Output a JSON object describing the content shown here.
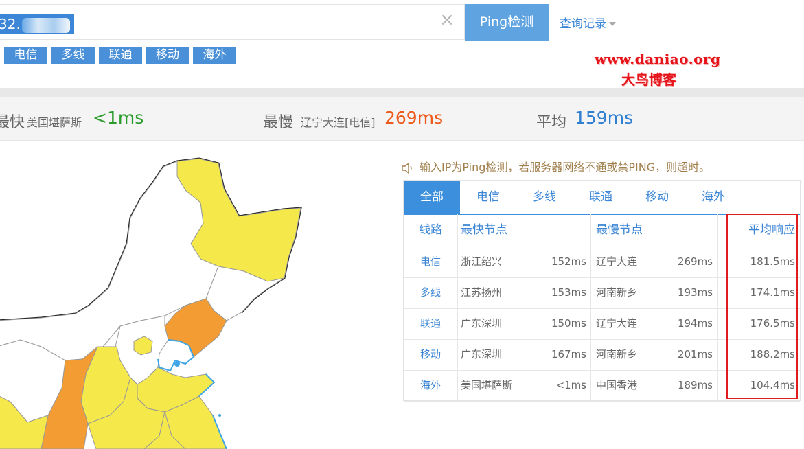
{
  "search": {
    "value": "32."
  },
  "ping_button": "Ping检测",
  "history": {
    "label": "查询记录"
  },
  "filters": [
    "电信",
    "多线",
    "联通",
    "移动",
    "海外"
  ],
  "watermark": {
    "line1": "www.daniao.org",
    "line2": "大鸟博客"
  },
  "stats": {
    "fastest": {
      "label": "最快",
      "place": "美国堪萨斯",
      "value": "<1ms"
    },
    "slowest": {
      "label": "最慢",
      "place": "辽宁大连[电信]",
      "value": "269ms"
    },
    "average": {
      "label": "平均",
      "value": "159ms"
    }
  },
  "notice": "输入IP为Ping检测，若服务器网络不通或禁PING，则超时。",
  "tabs": [
    "全部",
    "电信",
    "多线",
    "联通",
    "移动",
    "海外"
  ],
  "table": {
    "headers": {
      "line": "线路",
      "fastest": "最快节点",
      "slowest": "最慢节点",
      "avg": "平均响应"
    },
    "rows": [
      {
        "line": "电信",
        "fast_node": "浙江绍兴",
        "fast_ms": "152ms",
        "slow_node": "辽宁大连",
        "slow_ms": "269ms",
        "avg": "181.5ms"
      },
      {
        "line": "多线",
        "fast_node": "江苏扬州",
        "fast_ms": "153ms",
        "slow_node": "河南新乡",
        "slow_ms": "193ms",
        "avg": "174.1ms"
      },
      {
        "line": "联通",
        "fast_node": "广东深圳",
        "fast_ms": "150ms",
        "slow_node": "辽宁大连",
        "slow_ms": "194ms",
        "avg": "176.5ms"
      },
      {
        "line": "移动",
        "fast_node": "广东深圳",
        "fast_ms": "167ms",
        "slow_node": "河南新乡",
        "slow_ms": "201ms",
        "avg": "188.2ms"
      },
      {
        "line": "海外",
        "fast_node": "美国堪萨斯",
        "fast_ms": "<1ms",
        "slow_node": "中国香港",
        "slow_ms": "189ms",
        "avg": "104.4ms"
      }
    ]
  },
  "colors": {
    "accent": "#3b8fdc",
    "fast": "#2a9a2a",
    "slow": "#ee5a1c",
    "avg": "#2f7fd1",
    "map_yellow": "#f5e84a",
    "map_orange": "#f39c34",
    "highlight": "#e11b1b"
  }
}
